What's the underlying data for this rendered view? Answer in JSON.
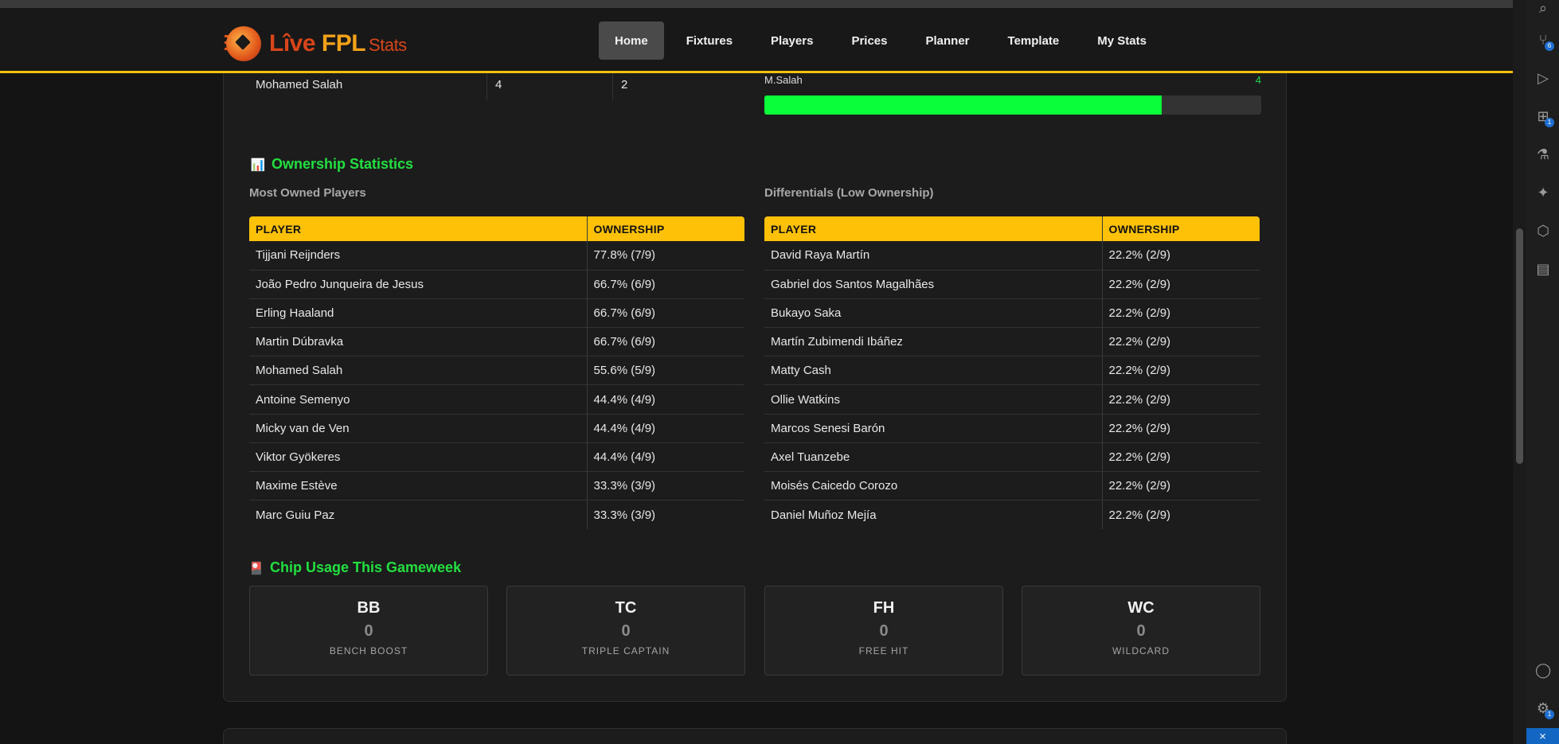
{
  "nav": {
    "logo_live": "Lîve",
    "logo_fpl": "FPL",
    "logo_stats": "Stats",
    "items": [
      "Home",
      "Fixtures",
      "Players",
      "Prices",
      "Planner",
      "Template",
      "My Stats"
    ],
    "active": "Home"
  },
  "previous_row": {
    "player": "Mohamed Salah",
    "col2": "4",
    "col3": "2"
  },
  "top_bar": {
    "label": "M.Salah",
    "value": "4",
    "fill_fraction": 0.8
  },
  "ownership": {
    "title": "Ownership Statistics",
    "most_owned": {
      "title": "Most Owned Players",
      "headers": [
        "PLAYER",
        "OWNERSHIP"
      ],
      "rows": [
        [
          "Tijjani Reijnders",
          "77.8% (7/9)"
        ],
        [
          "João Pedro Junqueira de Jesus",
          "66.7% (6/9)"
        ],
        [
          "Erling Haaland",
          "66.7% (6/9)"
        ],
        [
          "Martin Dúbravka",
          "66.7% (6/9)"
        ],
        [
          "Mohamed Salah",
          "55.6% (5/9)"
        ],
        [
          "Antoine Semenyo",
          "44.4% (4/9)"
        ],
        [
          "Micky van de Ven",
          "44.4% (4/9)"
        ],
        [
          "Viktor Gyökeres",
          "44.4% (4/9)"
        ],
        [
          "Maxime Estève",
          "33.3% (3/9)"
        ],
        [
          "Marc Guiu Paz",
          "33.3% (3/9)"
        ]
      ]
    },
    "differentials": {
      "title": "Differentials (Low Ownership)",
      "headers": [
        "PLAYER",
        "OWNERSHIP"
      ],
      "rows": [
        [
          "David Raya Martín",
          "22.2% (2/9)"
        ],
        [
          "Gabriel dos Santos Magalhães",
          "22.2% (2/9)"
        ],
        [
          "Bukayo Saka",
          "22.2% (2/9)"
        ],
        [
          "Martín Zubimendi Ibáñez",
          "22.2% (2/9)"
        ],
        [
          "Matty Cash",
          "22.2% (2/9)"
        ],
        [
          "Ollie Watkins",
          "22.2% (2/9)"
        ],
        [
          "Marcos Senesi Barón",
          "22.2% (2/9)"
        ],
        [
          "Axel Tuanzebe",
          "22.2% (2/9)"
        ],
        [
          "Moisés Caicedo Corozo",
          "22.2% (2/9)"
        ],
        [
          "Daniel Muñoz Mejía",
          "22.2% (2/9)"
        ]
      ]
    }
  },
  "chips": {
    "title": "Chip Usage This Gameweek",
    "items": [
      {
        "code": "BB",
        "value": "0",
        "name": "BENCH BOOST"
      },
      {
        "code": "TC",
        "value": "0",
        "name": "TRIPLE CAPTAIN"
      },
      {
        "code": "FH",
        "value": "0",
        "name": "FREE HIT"
      },
      {
        "code": "WC",
        "value": "0",
        "name": "WILDCARD"
      }
    ]
  },
  "colors": {
    "accent_yellow": "#ffc107",
    "title_green": "#22e03f",
    "bar_green": "#0aff3a",
    "background": "#141414"
  },
  "sidebar_icons": [
    "search-icon",
    "source-control-icon",
    "run-debug-icon",
    "extensions-icon",
    "testing-icon",
    "sparkle-icon",
    "package-icon",
    "book-icon",
    "account-icon",
    "settings-icon"
  ],
  "sidebar_badges": {
    "source_control": "6",
    "extensions": "1",
    "settings": "1"
  }
}
